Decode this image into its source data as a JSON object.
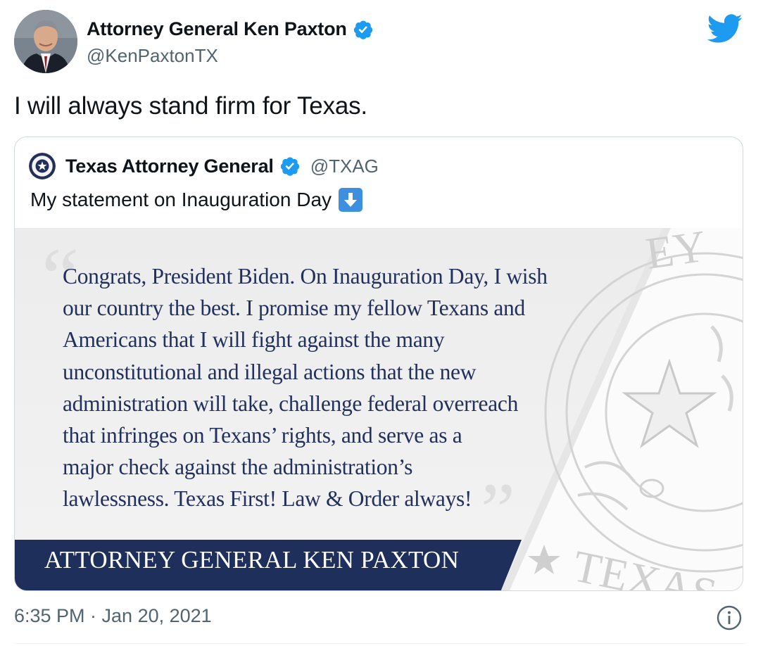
{
  "tweet": {
    "author_name": "Attorney General Ken Paxton",
    "author_handle": "@KenPaxtonTX",
    "text": "I will always stand firm for Texas.",
    "timestamp": "6:35 PM · Jan 20, 2021"
  },
  "quoted": {
    "author_name": "Texas Attorney General",
    "author_handle": "@TXAG",
    "text": "My statement on Inauguration Day",
    "emoji": "down-arrow-emoji",
    "statement_lines": [
      "Congrats, President Biden. On Inauguration Day, I wish",
      "our country the best. I promise my fellow Texans and",
      "Americans that I will fight against the many",
      "unconstitutional and illegal actions that the new",
      "administration will take, challenge federal overreach",
      "that infringes on Texans’ rights, and serve as a",
      "major check against the administration’s",
      "lawlessness. Texas First! Law & Order always!"
    ],
    "banner": "ATTORNEY GENERAL KEN PAXTON",
    "seal_text": "TEXAS",
    "seal_partial_text": "EY"
  },
  "icons": {
    "verified": "verified-badge-icon",
    "twitter": "twitter-bird-icon",
    "info": "info-icon"
  },
  "colors": {
    "twitter_blue": "#1d9bf0",
    "banner_navy": "#1e2f5c",
    "statement_text": "#22305c",
    "secondary_text": "#536471"
  }
}
